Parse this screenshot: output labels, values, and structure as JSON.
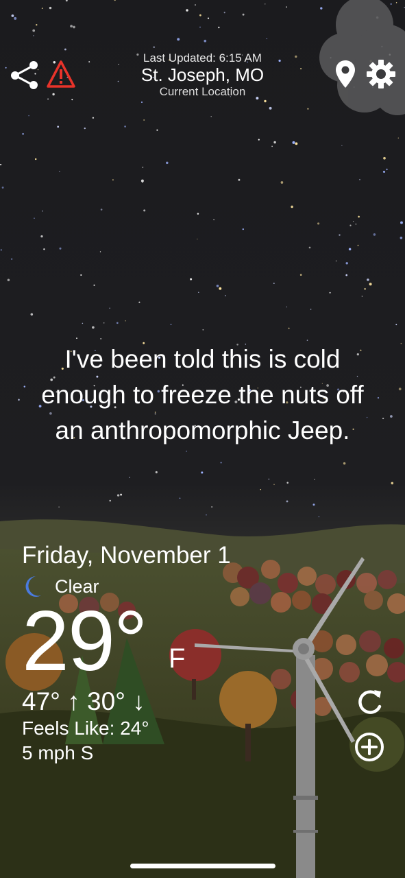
{
  "header": {
    "last_updated": "Last Updated: 6:15 AM",
    "city": "St. Joseph, MO",
    "location_label": "Current Location"
  },
  "icons": {
    "share": "share-icon",
    "alert": "warning-triangle-icon",
    "location": "map-pin-icon",
    "settings": "gear-icon",
    "condition": "crescent-moon-icon",
    "refresh": "refresh-icon",
    "add": "plus-circle-icon"
  },
  "quote": "I've been told this is cold enough to freeze the nuts off an anthropomorphic Jeep.",
  "weather": {
    "date": "Friday, November 1",
    "condition": "Clear",
    "temperature": "29°",
    "unit": "F",
    "high_low": "47° ↑ 30° ↓",
    "feels_like": "Feels Like: 24°",
    "wind": "5 mph S"
  },
  "colors": {
    "alert_red": "#e8332a",
    "moon_blue": "#4a7be0",
    "sky": "#1c1c1f"
  }
}
